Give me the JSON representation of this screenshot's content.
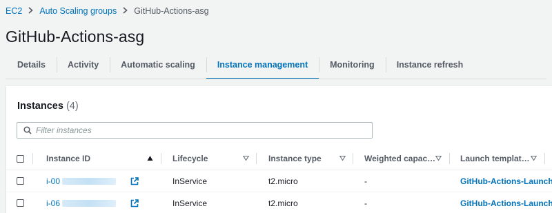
{
  "breadcrumb": {
    "items": [
      "EC2",
      "Auto Scaling groups"
    ],
    "current": "GitHub-Actions-asg"
  },
  "page": {
    "title": "GitHub-Actions-asg"
  },
  "tabs": [
    {
      "label": "Details",
      "active": false
    },
    {
      "label": "Activity",
      "active": false
    },
    {
      "label": "Automatic scaling",
      "active": false
    },
    {
      "label": "Instance management",
      "active": true
    },
    {
      "label": "Monitoring",
      "active": false
    },
    {
      "label": "Instance refresh",
      "active": false
    }
  ],
  "instances": {
    "title": "Instances",
    "count": "(4)",
    "filter_placeholder": "Filter instances",
    "columns": {
      "instance_id": "Instance ID",
      "lifecycle": "Lifecycle",
      "instance_type": "Instance type",
      "weighted_capacity": "Weighted capac…",
      "launch_template": "Launch templat…"
    },
    "rows": [
      {
        "instance_id": "i-00",
        "lifecycle": "InService",
        "instance_type": "t2.micro",
        "weighted_capacity": "-",
        "launch_template": "GitHub-Actions-Launch"
      },
      {
        "instance_id": "i-06",
        "lifecycle": "InService",
        "instance_type": "t2.micro",
        "weighted_capacity": "-",
        "launch_template": "GitHub-Actions-Launch"
      }
    ]
  },
  "colors": {
    "link": "#0073bb",
    "page_bg": "#f2f3f3",
    "text": "#16191f"
  },
  "icons": [
    "chevron-right-icon",
    "search-icon",
    "sort-ascending-icon",
    "sort-descending-icon",
    "external-link-icon"
  ]
}
